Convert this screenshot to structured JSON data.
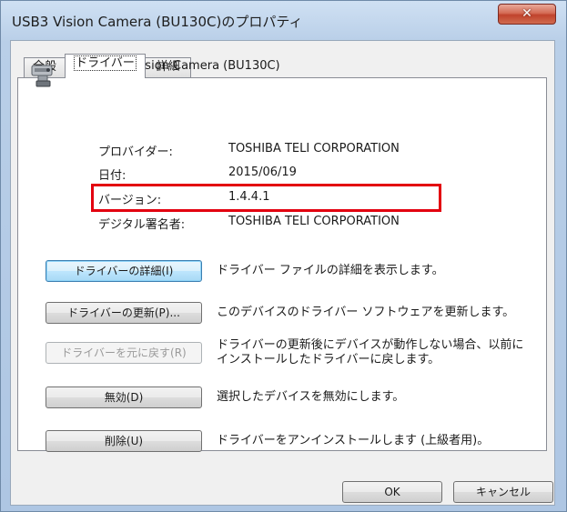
{
  "window": {
    "title": "USB3 Vision Camera (BU130C)のプロパティ",
    "close_label": "✕"
  },
  "tabs": [
    {
      "label": "全般"
    },
    {
      "label": "ドライバー"
    },
    {
      "label": "詳細"
    }
  ],
  "device": {
    "icon": "usb-camera-icon",
    "name": "USB3 Vision Camera (BU130C)"
  },
  "properties": [
    {
      "label": "プロバイダー:",
      "value": "TOSHIBA TELI CORPORATION"
    },
    {
      "label": "日付:",
      "value": "2015/06/19"
    },
    {
      "label": "バージョン:",
      "value": "1.4.4.1"
    },
    {
      "label": "デジタル署名者:",
      "value": "TOSHIBA TELI CORPORATION"
    }
  ],
  "actions": [
    {
      "label": "ドライバーの詳細(I)",
      "description": "ドライバー ファイルの詳細を表示します。"
    },
    {
      "label": "ドライバーの更新(P)...",
      "description": "このデバイスのドライバー ソフトウェアを更新します。"
    },
    {
      "label": "ドライバーを元に戻す(R)",
      "description": "ドライバーの更新後にデバイスが動作しない場合、以前に",
      "description2": "インストールしたドライバーに戻します。"
    },
    {
      "label": "無効(D)",
      "description": "選択したデバイスを無効にします。"
    },
    {
      "label": "削除(U)",
      "description": "ドライバーをアンインストールします (上級者用)。"
    }
  ],
  "footer": {
    "ok_label": "OK",
    "cancel_label": "キャンセル"
  },
  "highlight_color": "#e3000f"
}
